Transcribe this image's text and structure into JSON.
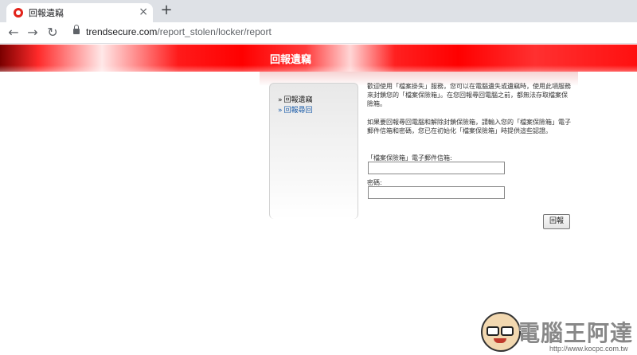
{
  "browser": {
    "tab_title": "回報遺竊",
    "tab_close": "×",
    "new_tab": "+",
    "back": "←",
    "forward": "→",
    "reload": "↻",
    "url_host": "trendsecure.com",
    "url_path": "/report_stolen/locker/report"
  },
  "page": {
    "heading": "回報遺竊",
    "sidebar": {
      "items": [
        {
          "arrow": "»",
          "label": "回報遺竊"
        },
        {
          "arrow": "»",
          "label": "回報尋回"
        }
      ]
    },
    "main": {
      "intro": "歡迎使用「檔案掛失」服務，您可以在電腦遺失或遺竊時，使用此項服務來封鎖您的「檔案保險箱」。在您回報尋回電腦之前，都無法存取檔案保險箱。",
      "instructions": "如果要回報尋回電腦和解除封鎖保險箱，請輸入您的「檔案保險箱」電子郵件信箱和密碼，您已在初始化「檔案保險箱」時提供這些認證。",
      "email_label": "「檔案保險箱」電子郵件信箱:",
      "email_value": "",
      "password_label": "密碼:",
      "password_value": "",
      "submit_label": "回報"
    }
  },
  "watermark": {
    "text": "電腦王阿達",
    "url": "http://www.kocpc.com.tw"
  },
  "colors": {
    "banner_red": "#ff0000",
    "link_blue": "#1f5faa"
  }
}
